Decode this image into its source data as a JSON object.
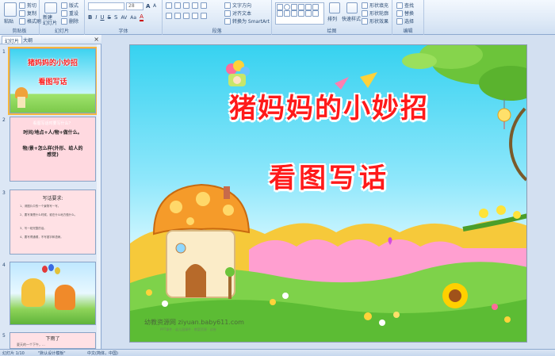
{
  "ribbon": {
    "clipboard": {
      "paste": "粘贴",
      "cut": "剪切",
      "copy": "复制",
      "format_painter": "格式刷",
      "label": "剪贴板"
    },
    "slides": {
      "new_slide": "新建\n幻灯片",
      "layout": "版式",
      "reset": "重设",
      "delete": "删除",
      "label": "幻灯片"
    },
    "font": {
      "font_size": "28",
      "label": "字体"
    },
    "paragraph": {
      "text_direction": "文字方向",
      "align_text": "对齐文本",
      "smartart": "转换为 SmartArt",
      "label": "段落"
    },
    "drawing": {
      "arrange": "排列",
      "quick_styles": "快速样式",
      "shape_fill": "形状填充",
      "shape_outline": "形状轮廓",
      "shape_effects": "形状效果",
      "label": "绘图"
    },
    "editing": {
      "find": "查找",
      "replace": "替换",
      "select": "选择",
      "label": "编辑"
    }
  },
  "panel": {
    "tabs": [
      "幻灯片",
      "大纲"
    ],
    "close": "×",
    "thumbs": [
      {
        "num": "1",
        "title": "猪妈妈的小妙招",
        "subtitle": "看图写话"
      },
      {
        "num": "2",
        "header": "看图写话时要写什么？",
        "lines": [
          "时间/地点+人/物+做什么。",
          "物/景+怎么样(外形、给人的感觉)"
        ]
      },
      {
        "num": "3",
        "header": "写话要求:",
        "items": [
          "1、请图片中的一个景物写一写。",
          "2、要写清楚什么时候，谁在什么地方做什么。",
          "3、写一段完整的话。",
          "4、要写得通顺，不写错字和语病。"
        ]
      },
      {
        "num": "4"
      },
      {
        "num": "5",
        "header": "下雨了",
        "line": "夏天的一个下午，..."
      }
    ]
  },
  "slide": {
    "title": "猪妈妈的小妙招",
    "subtitle": "看图写话",
    "watermark": "幼教资源网 ziyuan.baby611.com",
    "watermark_sub": "PPT课件 · 幼儿园课件 · 教案资源 · 试卷"
  },
  "status": {
    "slide_info": "幻灯片 1/10",
    "theme": "\"默认设计模板\"",
    "language": "中文(简体，中国)"
  },
  "colors": {
    "title_red": "#ff1a1a",
    "sky_top": "#37d2f0",
    "ribbon": "#dfeaf7"
  }
}
